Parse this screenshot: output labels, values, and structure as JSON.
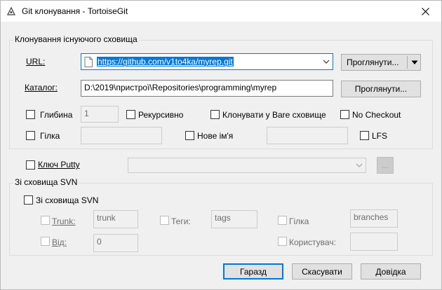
{
  "window": {
    "title": "Git клонування - TortoiseGit"
  },
  "existing_repo": {
    "group_title": "Клонування існуючого сховища",
    "url_label": "URL:",
    "url_value": "https://github.com/v1to4ka/myrep.git",
    "browse_url_label": "Проглянути...",
    "directory_label": "Каталог:",
    "directory_value": "D:\\2019\\пристрої\\Repositories\\programming\\myrep",
    "browse_dir_label": "Проглянути...",
    "depth_label": "Глибина",
    "depth_value": "1",
    "recursive_label": "Рекурсивно",
    "bare_label": "Клонувати у Bare сховище",
    "no_checkout_label": "No Checkout",
    "branch_label": "Гілка",
    "branch_value": "",
    "origin_label": "Нове ім'я",
    "origin_value": "",
    "lfs_label": "LFS"
  },
  "putty": {
    "key_label": "Ключ Putty",
    "key_value": "",
    "browse_label": "..."
  },
  "svn": {
    "group_title": "Зі сховища SVN",
    "from_svn_label": "Зі сховища SVN",
    "trunk_label": "Trunk:",
    "trunk_value": "trunk",
    "tags_label": "Теги:",
    "tags_value": "tags",
    "branch_label": "Гілка",
    "branch_value": "branches",
    "from_label": "Від:",
    "from_value": "0",
    "user_label": "Користувач:",
    "user_value": ""
  },
  "buttons": {
    "ok": "Гаразд",
    "cancel": "Скасувати",
    "help": "Довідка"
  },
  "colors": {
    "accent": "#0078d7",
    "selection": "#0078d7"
  }
}
